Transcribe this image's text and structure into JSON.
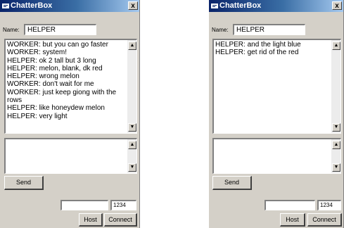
{
  "windows": [
    {
      "title": "ChatterBox",
      "close_label": "x",
      "name_label": "Name:",
      "name_value": "HELPER",
      "chat_lines": [
        "WORKER: but you can go faster",
        "WORKER: system!",
        "HELPER: ok 2 tall but 3 long",
        "HELPER: melon, blank, dk red",
        "HELPER: wrong melon",
        "WORKER: don't wait for me",
        "WORKER: just keep giong with the",
        "rows",
        "HELPER: like honeydew melon",
        "HELPER: very light"
      ],
      "message_input": "",
      "send_label": "Send",
      "host_address": "",
      "port": "1234",
      "host_label": "Host",
      "connect_label": "Connect"
    },
    {
      "title": "ChatterBox",
      "close_label": "x",
      "name_label": "Name:",
      "name_value": "HELPER",
      "chat_lines": [
        "HELPER: and the light blue",
        "HELPER: get rid of the red"
      ],
      "message_input": "",
      "send_label": "Send",
      "host_address": "",
      "port": "1234",
      "host_label": "Host",
      "connect_label": "Connect"
    }
  ]
}
